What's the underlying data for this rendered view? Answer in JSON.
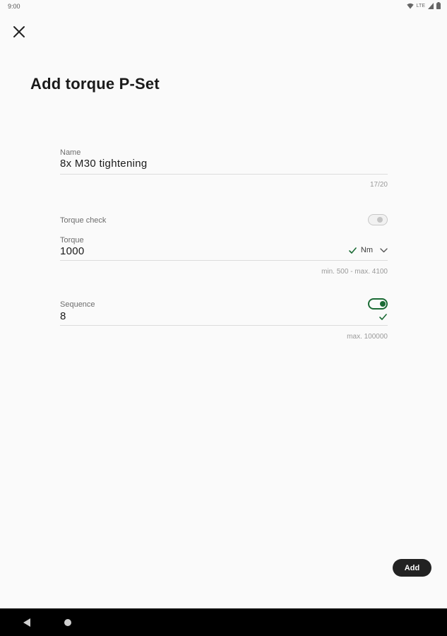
{
  "status_bar": {
    "time": "9:00",
    "network": "LTE",
    "icons": [
      "wifi-icon",
      "signal-icon",
      "battery-icon"
    ]
  },
  "header": {
    "close_icon": "close-icon",
    "title": "Add torque P-Set"
  },
  "form": {
    "name": {
      "label": "Name",
      "value": "8x M30 tightening",
      "counter": "17/20"
    },
    "torque_check": {
      "label": "Torque check",
      "enabled": false
    },
    "torque": {
      "label": "Torque",
      "value": "1000",
      "valid": true,
      "unit": "Nm",
      "helper": "min. 500 - max. 4100"
    },
    "sequence": {
      "label": "Sequence",
      "value": "8",
      "enabled": true,
      "valid": true,
      "helper": "max. 100000"
    }
  },
  "actions": {
    "add_label": "Add"
  },
  "colors": {
    "accent": "#1b6b35",
    "button_bg": "#222222",
    "background": "#fafafa"
  }
}
